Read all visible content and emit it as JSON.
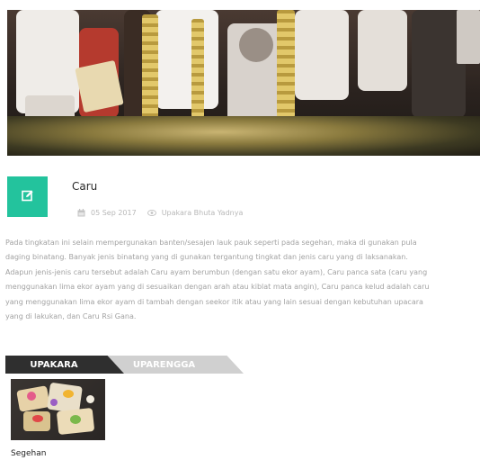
{
  "post": {
    "title": "Caru",
    "date": "05 Sep 2017",
    "category": "Upakara Bhuta Yadnya"
  },
  "body_lines": [
    "Pada tingkatan ini selain mempergunakan banten/sesajen lauk pauk seperti pada segehan, maka di gunakan pula",
    "daging binatang. Banyak jenis binatang yang di gunakan tergantung tingkat dan jenis caru yang di laksanakan.",
    "Adapun jenis-jenis caru tersebut adalah Caru ayam berumbun (dengan satu ekor ayam), Caru panca sata (caru yang",
    "menggunakan lima ekor ayam yang di sesuaikan dengan arah atau kiblat mata angin), Caru panca kelud adalah caru",
    "yang menggunakan lima ekor ayam di tambah dengan seekor itik atau yang lain sesuai dengan kebutuhan upacara",
    "yang di lakukan, dan Caru Rsi Gana."
  ],
  "tabs": [
    {
      "label": "UPAKARA",
      "active": true
    },
    {
      "label": "UPARENGGA",
      "active": false
    }
  ],
  "items": [
    {
      "label": "Segehan"
    }
  ],
  "icons": {
    "edit": "edit-icon",
    "calendar": "calendar-icon",
    "eye": "eye-icon"
  },
  "colors": {
    "accent": "#23c39d",
    "tab_active": "#2f2f2f",
    "tab_inactive": "#d0d0d0"
  }
}
